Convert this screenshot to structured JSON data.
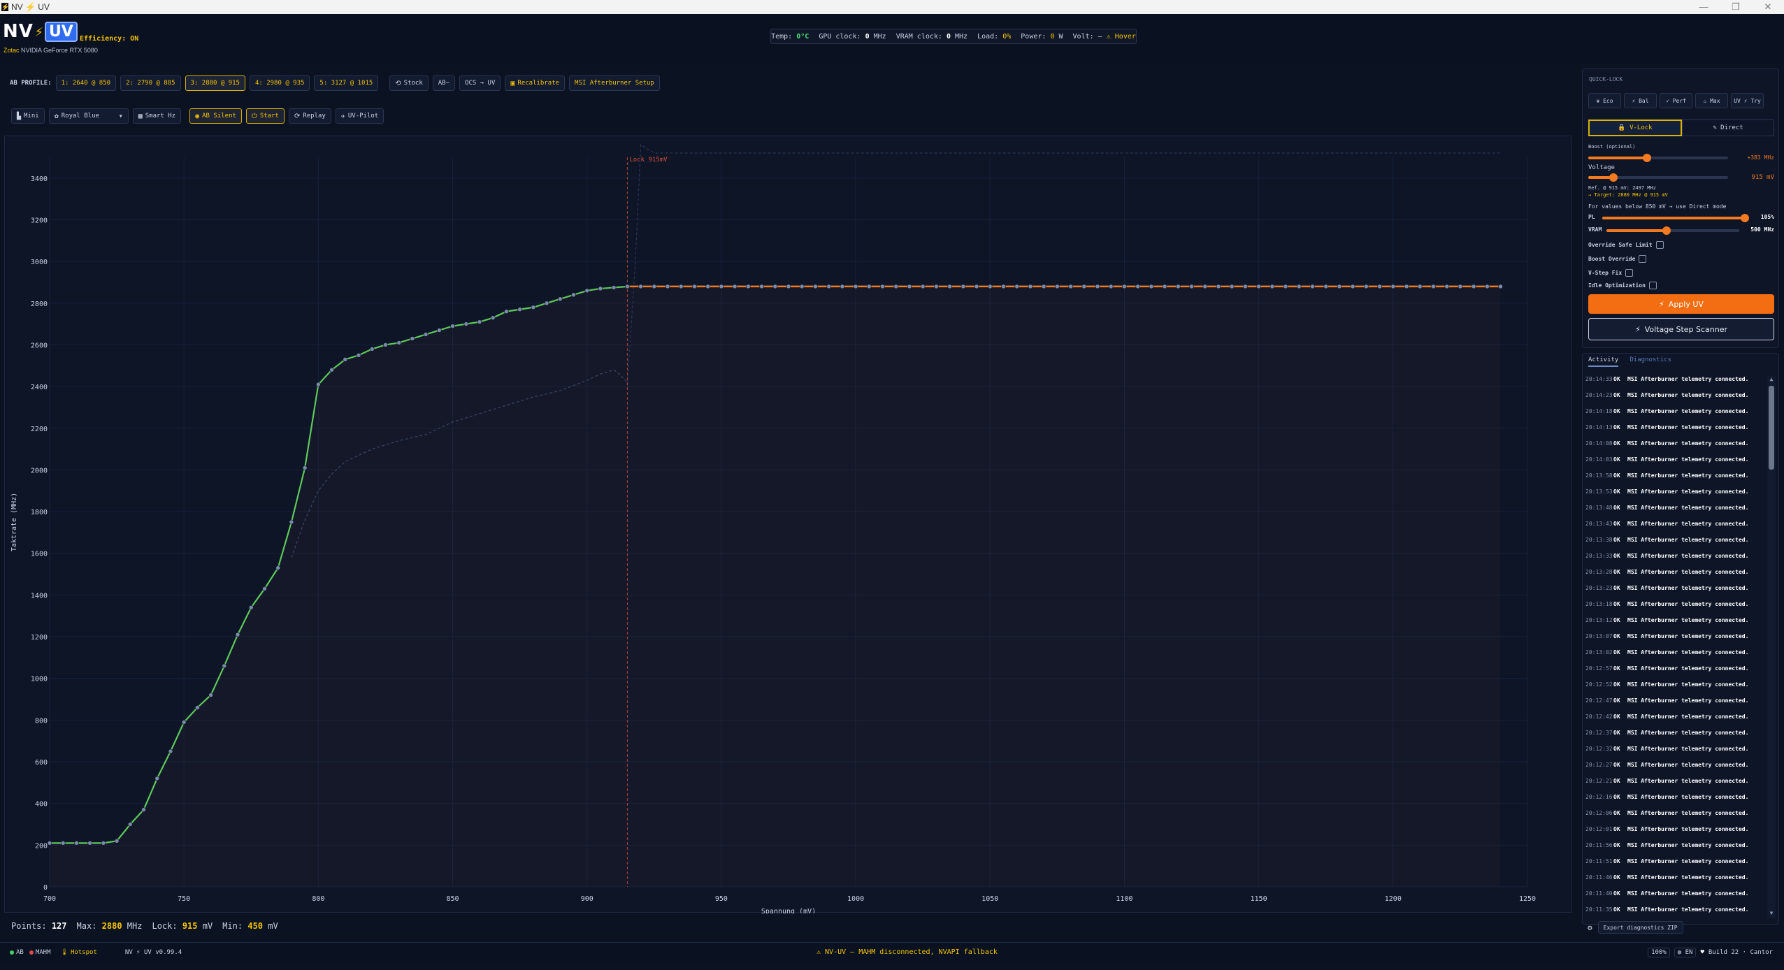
{
  "window": {
    "title": "NV ⚡ UV",
    "minimize": "—",
    "maximize": "❐",
    "close": "✕"
  },
  "brand": {
    "nv": "NV",
    "bolt": "⚡",
    "uv": "UV",
    "efficiency": "Efficiency: ON",
    "vendor": "Zotac",
    "gpu": "NVIDIA GeForce RTX 5080"
  },
  "telemetry": {
    "temp_label": "Temp:",
    "temp_value": "0",
    "temp_unit": "°C",
    "gpu_label": "GPU clock:",
    "gpu_value": "0",
    "gpu_unit": "MHz",
    "vram_label": "VRAM clock:",
    "vram_value": "0",
    "vram_unit": "MHz",
    "load_label": "Load:",
    "load_value": "0",
    "load_unit": "%",
    "power_label": "Power:",
    "power_value": "0",
    "power_unit": "W",
    "volt_label": "Volt:",
    "volt_value": "—",
    "hover": "⚠ Hover"
  },
  "profiles": {
    "label": "AB PROFILE:",
    "items": [
      "1: 2640 @ 850",
      "2: 2790 @ 885",
      "3: 2880 @ 915",
      "4: 2980 @ 935",
      "5: 3127 @ 1015"
    ],
    "active_index": 2,
    "stock": "Stock",
    "abminus": "AB−",
    "ocs": "OCS → UV",
    "recalibrate": "Recalibrate",
    "msi_setup": "MSI Afterburner Setup"
  },
  "modes": {
    "mini": "Mini",
    "theme": "Royal Blue",
    "smart_hz": "Smart Hz",
    "ab_silent": "AB Silent",
    "start": "Start",
    "replay": "Replay",
    "uv_pilot": "UV-Pilot"
  },
  "icons": {
    "stock": "refresh-icon",
    "recalibrate": "calibrate-icon",
    "mini": "mini-icon",
    "theme": "palette-icon",
    "smart": "monitor-icon",
    "silent": "eye-icon",
    "start": "power-icon",
    "replay": "replay-icon",
    "pilot": "pilot-icon"
  },
  "colors": {
    "accent": "#f5c400",
    "orange": "#f37a1f",
    "green": "#5ec85a",
    "lock_line": "#d9533b",
    "bg": "#0b1222"
  },
  "chart_data": {
    "type": "line",
    "xlabel": "Spannung (mV)",
    "ylabel": "Taktrate (MHz)",
    "xlim": [
      700,
      1250
    ],
    "ylim": [
      0,
      3500
    ],
    "x_ticks": [
      700,
      750,
      800,
      850,
      900,
      950,
      1000,
      1050,
      1100,
      1150,
      1200,
      1250
    ],
    "y_ticks": [
      0,
      200,
      400,
      600,
      800,
      1000,
      1200,
      1400,
      1600,
      1800,
      2000,
      2200,
      2400,
      2600,
      2800,
      3000,
      3200,
      3400
    ],
    "grid": true,
    "lock_label": "Lock 915mV",
    "lock_x": 915,
    "lock_y": 2880,
    "max_x": 1240,
    "curve": [
      [
        700,
        210
      ],
      [
        705,
        210
      ],
      [
        710,
        210
      ],
      [
        715,
        210
      ],
      [
        720,
        210
      ],
      [
        725,
        220
      ],
      [
        730,
        300
      ],
      [
        735,
        370
      ],
      [
        740,
        520
      ],
      [
        745,
        650
      ],
      [
        750,
        790
      ],
      [
        755,
        860
      ],
      [
        760,
        920
      ],
      [
        765,
        1060
      ],
      [
        770,
        1210
      ],
      [
        775,
        1340
      ],
      [
        780,
        1430
      ],
      [
        785,
        1530
      ],
      [
        790,
        1750
      ],
      [
        795,
        2010
      ],
      [
        800,
        2410
      ],
      [
        805,
        2480
      ],
      [
        810,
        2530
      ],
      [
        815,
        2550
      ],
      [
        820,
        2580
      ],
      [
        825,
        2600
      ],
      [
        830,
        2610
      ],
      [
        835,
        2630
      ],
      [
        840,
        2650
      ],
      [
        845,
        2670
      ],
      [
        850,
        2690
      ],
      [
        855,
        2700
      ],
      [
        860,
        2710
      ],
      [
        865,
        2730
      ],
      [
        870,
        2760
      ],
      [
        875,
        2770
      ],
      [
        880,
        2780
      ],
      [
        885,
        2800
      ],
      [
        890,
        2820
      ],
      [
        895,
        2840
      ],
      [
        900,
        2860
      ],
      [
        905,
        2870
      ],
      [
        910,
        2875
      ],
      [
        915,
        2880
      ]
    ],
    "reference": [
      [
        790,
        1580
      ],
      [
        795,
        1760
      ],
      [
        800,
        1900
      ],
      [
        805,
        1980
      ],
      [
        810,
        2040
      ],
      [
        820,
        2100
      ],
      [
        830,
        2140
      ],
      [
        840,
        2170
      ],
      [
        850,
        2230
      ],
      [
        860,
        2270
      ],
      [
        870,
        2310
      ],
      [
        880,
        2350
      ],
      [
        890,
        2380
      ],
      [
        900,
        2430
      ],
      [
        905,
        2460
      ],
      [
        910,
        2480
      ],
      [
        912,
        2460
      ],
      [
        915,
        2420
      ]
    ],
    "ghost": [
      [
        915,
        2400
      ],
      [
        918,
        3000
      ],
      [
        920,
        3560
      ],
      [
        925,
        3520
      ],
      [
        1240,
        3520
      ]
    ]
  },
  "status": {
    "points_label": "Points:",
    "points": "127",
    "max_label": "Max:",
    "max": "2880",
    "max_unit": "MHz",
    "lock_label": "Lock:",
    "lock": "915",
    "lock_unit": "mV",
    "min_label": "Min:",
    "min": "450",
    "min_unit": "mV"
  },
  "footer": {
    "ab": "AB",
    "mahm": "MAHM",
    "hotspot": "Hotspot",
    "version": "NV ⚡ UV v0.99.4",
    "warning": "⚠ NV-UV — MAHM disconnected, NVAPI fallback",
    "zoom": "100%",
    "lang": "EN",
    "build": "Build 22 · Cantor"
  },
  "quicklock": {
    "title": "QUICK-LOCK",
    "presets": [
      "Eco",
      "Bal",
      "Perf",
      "Max",
      "UV ⚡ Try"
    ],
    "preset_icons": [
      "leaf-icon",
      "bolt-icon",
      "rocket-icon",
      "fire-icon",
      "uv-icon"
    ],
    "vlock": "V-Lock",
    "direct": "Direct",
    "boost_label": "Boost (optional)",
    "boost_value": "+383 MHz",
    "boost_frac": 0.42,
    "voltage_label": "Voltage",
    "voltage_value": "915 mV",
    "voltage_frac": 0.18,
    "ref_line": "Ref. @ 915 mV: 2497 MHz",
    "target_line": "→ Target: 2880 MHz @ 915 mV",
    "hint": "For values below 850 mV → use Direct mode",
    "pl_label": "PL",
    "pl_value": "105%",
    "pl_frac": 0.97,
    "vram_label": "VRAM",
    "vram_value": "500 MHz",
    "vram_frac": 0.45,
    "checks": [
      "Override Safe Limit",
      "Boost Override",
      "V-Step Fix",
      "Idle Optimization"
    ],
    "apply": "Apply UV",
    "scanner": "Voltage Step Scanner"
  },
  "activity": {
    "tab_activity": "Activity",
    "tab_diag": "Diagnostics",
    "level": "OK",
    "message": "MSI Afterburner telemetry connected.",
    "times": [
      "20:14:33",
      "20:14:23",
      "20:14:18",
      "20:14:13",
      "20:14:08",
      "20:14:03",
      "20:13:58",
      "20:13:53",
      "20:13:48",
      "20:13:43",
      "20:13:38",
      "20:13:33",
      "20:13:28",
      "20:13:23",
      "20:13:18",
      "20:13:12",
      "20:13:07",
      "20:13:02",
      "20:12:57",
      "20:12:52",
      "20:12:47",
      "20:12:42",
      "20:12:37",
      "20:12:32",
      "20:12:27",
      "20:12:21",
      "20:12:16",
      "20:12:06",
      "20:12:01",
      "20:11:56",
      "20:11:51",
      "20:11:46",
      "20:11:40",
      "20:11:35"
    ],
    "export": "Export diagnostics ZIP"
  }
}
